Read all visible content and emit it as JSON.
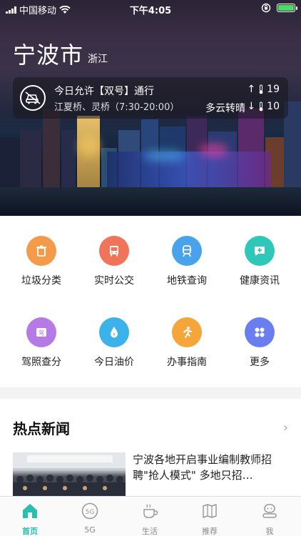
{
  "status_bar": {
    "carrier": "中国移动",
    "time": "下午4:05"
  },
  "header": {
    "city": "宁波市",
    "province": "浙江"
  },
  "notice": {
    "traffic_rule": "今日允许【双号】通行",
    "bridges": "江夏桥、灵桥（7:30-20:00）",
    "temp_high": "19",
    "temp_low": "10",
    "weather": "多云转晴"
  },
  "services": [
    {
      "label": "垃圾分类",
      "icon": "trash-icon",
      "color": "#f39a4b"
    },
    {
      "label": "实时公交",
      "icon": "bus-icon",
      "color": "#f0745a"
    },
    {
      "label": "地铁查询",
      "icon": "subway-icon",
      "color": "#4aa3ea"
    },
    {
      "label": "健康资讯",
      "icon": "health-icon",
      "color": "#2fc8b8"
    },
    {
      "label": "驾照查分",
      "icon": "license-icon",
      "color": "#b57ae6"
    },
    {
      "label": "今日油价",
      "icon": "oil-icon",
      "color": "#3cb2ea"
    },
    {
      "label": "办事指南",
      "icon": "runner-icon",
      "color": "#f5a63a"
    },
    {
      "label": "更多",
      "icon": "more-icon",
      "color": "#6b7ef0"
    }
  ],
  "news": {
    "section_title": "热点新闻",
    "headline": "宁波各地开启事业编制教师招聘\"抢人模式\" 多地只招…"
  },
  "tabs": [
    {
      "label": "首页",
      "icon": "home-icon"
    },
    {
      "label": "5G",
      "icon": "5g-icon"
    },
    {
      "label": "生活",
      "icon": "coffee-icon"
    },
    {
      "label": "推荐",
      "icon": "map-icon"
    },
    {
      "label": "我",
      "icon": "profile-icon"
    }
  ],
  "accent_color": "#27bfae"
}
